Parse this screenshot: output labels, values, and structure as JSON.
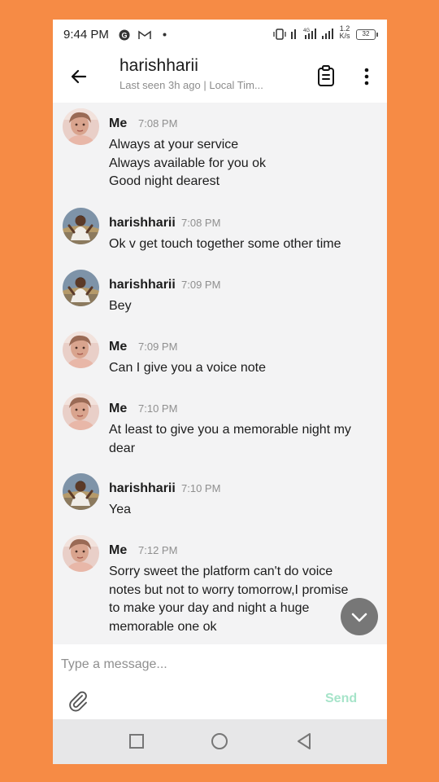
{
  "status_bar": {
    "time": "9:44 PM",
    "icons": [
      "app-icon",
      "gmail-icon",
      "dot-icon",
      "vibrate-icon",
      "signal-4g-icon",
      "signal-icon"
    ],
    "data_speed_value": "1.2",
    "data_speed_unit": "K/s",
    "battery": "32"
  },
  "header": {
    "title": "harishharii",
    "subtitle": "Last seen 3h ago | Local Tim..."
  },
  "messages": [
    {
      "sender": "Me",
      "time": "7:08 PM",
      "avatar": "me",
      "text": [
        "Always at your service",
        "Always available for you ok",
        "Good night dearest"
      ]
    },
    {
      "sender": "harishharii",
      "time": "7:08 PM",
      "avatar": "other",
      "text": [
        "Ok v get touch together some other time"
      ]
    },
    {
      "sender": "harishharii",
      "time": "7:09 PM",
      "avatar": "other",
      "text": [
        "Bey"
      ]
    },
    {
      "sender": "Me",
      "time": "7:09 PM",
      "avatar": "me",
      "text": [
        "Can I give you a voice note"
      ]
    },
    {
      "sender": "Me",
      "time": "7:10 PM",
      "avatar": "me",
      "text": [
        "At least to give you a memorable night my",
        "dear"
      ]
    },
    {
      "sender": "harishharii",
      "time": "7:10 PM",
      "avatar": "other",
      "text": [
        "Yea"
      ]
    },
    {
      "sender": "Me",
      "time": "7:12 PM",
      "avatar": "me",
      "text": [
        "Sorry sweet the platform can't do voice",
        "notes but not to worry tomorrow,I promise",
        "to make your day and night a huge",
        "memorable one ok"
      ]
    }
  ],
  "composer": {
    "placeholder": "Type a message...",
    "value": "",
    "send_label": "Send"
  },
  "colors": {
    "background": "#F68B45",
    "send_disabled": "#A6E4C9",
    "scroll_button": "#777777"
  }
}
